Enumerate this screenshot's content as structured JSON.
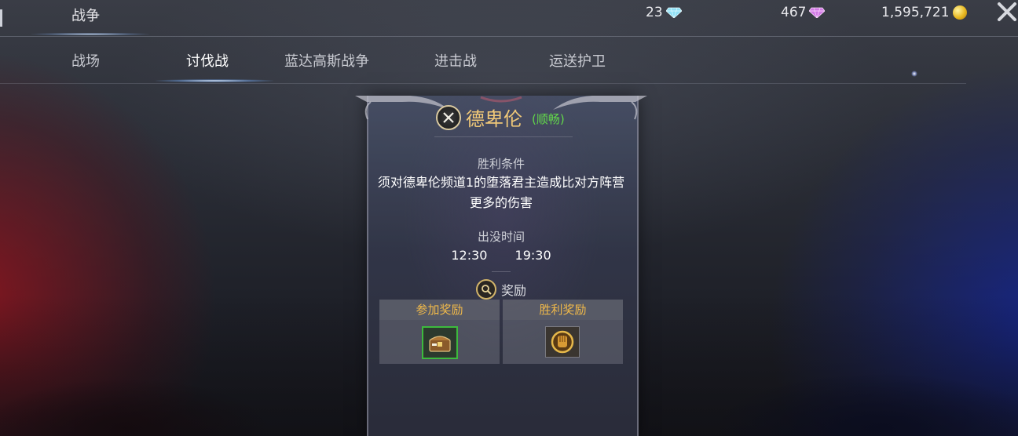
{
  "header": {
    "title": "战争",
    "currencies": [
      {
        "name": "diamond",
        "value": "23",
        "icon": "diamond-blue-icon",
        "color": "#8fe0f5"
      },
      {
        "name": "gem",
        "value": "467",
        "icon": "gem-purple-icon",
        "color": "#d27ae6"
      },
      {
        "name": "gold",
        "value": "1,595,721",
        "icon": "gold-coin-icon",
        "color": "#e8b820"
      }
    ],
    "close_icon": "close-icon"
  },
  "tabs": [
    {
      "label": "战场",
      "active": false
    },
    {
      "label": "讨伐战",
      "active": true
    },
    {
      "label": "蓝达高斯战争",
      "active": false
    },
    {
      "label": "进击战",
      "active": false
    },
    {
      "label": "运送护卫",
      "active": false
    }
  ],
  "panel": {
    "boss_name": "德卑伦",
    "boss_status": "(顺畅)",
    "victory_label": "胜利条件",
    "victory_text": "须对德卑伦频道1的堕落君主造成比对方阵营更多的伤害",
    "spawn_label": "出没时间",
    "spawn_times": [
      "12:30",
      "19:30"
    ],
    "reward_label": "奖励",
    "rewards": [
      {
        "header": "参加奖励",
        "icon": "treasure-chest-icon"
      },
      {
        "header": "胜利奖励",
        "icon": "gold-gauntlet-icon"
      }
    ]
  },
  "colors": {
    "accent_gold": "#f0c878",
    "status_green": "#62d84a",
    "reward_header": "#f0b94a"
  }
}
